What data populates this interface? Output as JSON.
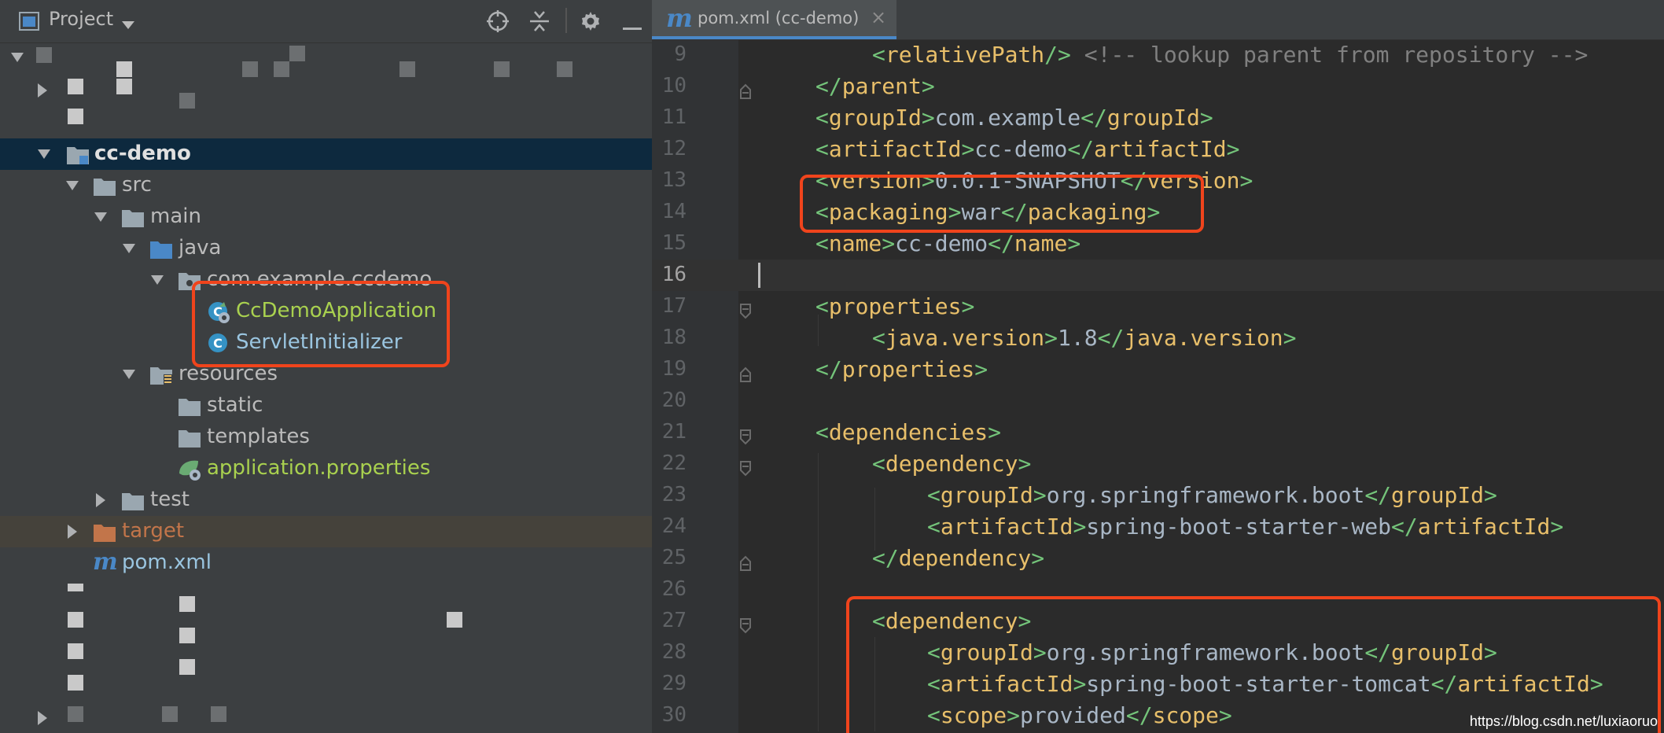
{
  "project_panel": {
    "title": "Project",
    "icons": [
      "project-view-icon",
      "dropdown-chevron-icon",
      "locate-icon",
      "collapse-all-icon",
      "gear-icon",
      "minimize-icon"
    ],
    "tree": {
      "root": "cc-demo",
      "src": "src",
      "main": "main",
      "java": "java",
      "package": "com.example.ccdemo",
      "class_app": "CcDemoApplication",
      "class_servlet": "ServletInitializer",
      "resources": "resources",
      "static": "static",
      "templates": "templates",
      "app_props": "application.properties",
      "test": "test",
      "target": "target",
      "pom": "pom.xml"
    }
  },
  "editor": {
    "tab": {
      "icon": "maven-icon",
      "label": "pom.xml (cc-demo)",
      "close": "×"
    },
    "lines": [
      {
        "n": "9"
      },
      {
        "n": "10"
      },
      {
        "n": "11"
      },
      {
        "n": "12"
      },
      {
        "n": "13"
      },
      {
        "n": "14"
      },
      {
        "n": "15"
      },
      {
        "n": "16"
      },
      {
        "n": "17"
      },
      {
        "n": "18"
      },
      {
        "n": "19"
      },
      {
        "n": "20"
      },
      {
        "n": "21"
      },
      {
        "n": "22"
      },
      {
        "n": "23"
      },
      {
        "n": "24"
      },
      {
        "n": "25"
      },
      {
        "n": "26"
      },
      {
        "n": "27"
      },
      {
        "n": "28"
      },
      {
        "n": "29"
      },
      {
        "n": "30"
      }
    ],
    "code": {
      "l9_tag": "relativePath",
      "l9_comment": "<!-- lookup parent from repository -->",
      "l10_tag": "parent",
      "l11_tag": "groupId",
      "l11_val": "com.example",
      "l12_tag": "artifactId",
      "l12_val": "cc-demo",
      "l13_tag": "version",
      "l13_val": "0.0.1-SNAPSHOT",
      "l14_tag": "packaging",
      "l14_val": "war",
      "l15_tag": "name",
      "l15_val": "cc-demo",
      "l17_tag": "properties",
      "l18_tag": "java.version",
      "l18_val": "1.8",
      "l19_tag": "properties",
      "l21_tag": "dependencies",
      "l22_tag": "dependency",
      "l23_tag": "groupId",
      "l23_val": "org.springframework.boot",
      "l24_tag": "artifactId",
      "l24_val": "spring-boot-starter-web",
      "l25_tag": "dependency",
      "l27_tag": "dependency",
      "l28_tag": "groupId",
      "l28_val": "org.springframework.boot",
      "l29_tag": "artifactId",
      "l29_val": "spring-boot-starter-tomcat",
      "l30_tag": "scope",
      "l30_val": "provided"
    }
  },
  "watermark": "https://blog.csdn.net/luxiaoruo",
  "colors": {
    "highlight": "#f0441c",
    "tag": "#e8bf6a",
    "punct": "#74c47a",
    "text": "#a9b7c6",
    "comment": "#808080"
  }
}
